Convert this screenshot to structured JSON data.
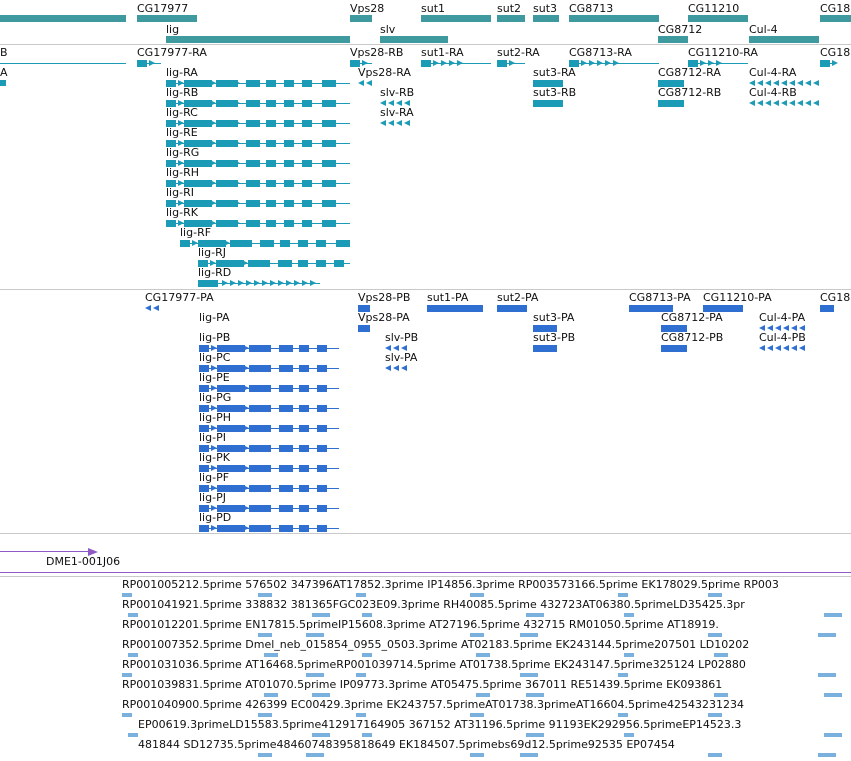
{
  "colors": {
    "gene": "#3f9aa0",
    "transcript_rna": "#1b9bb5",
    "transcript_protein": "#2e6fd1",
    "clone": "#8f5ac6",
    "est": "#79b0dd",
    "separator": "#c9c9c9"
  },
  "tracks": {
    "genes": {
      "labels": [
        "CG17977",
        "Vps28",
        "sut1",
        "sut2",
        "sut3",
        "CG8713",
        "CG11210",
        "CG18",
        "lig",
        "slv",
        "CG8712",
        "Cul-4"
      ]
    },
    "transcripts": {
      "labels": [
        "B",
        "A",
        "CG17977-RA",
        "Vps28-RB",
        "sut1-RA",
        "sut2-RA",
        "CG8713-RA",
        "CG11210-RA",
        "CG18",
        "lig-RA",
        "Vps28-RA",
        "sut3-RA",
        "CG8712-RA",
        "Cul-4-RA",
        "lig-RB",
        "slv-RB",
        "sut3-RB",
        "CG8712-RB",
        "Cul-4-RB",
        "lig-RC",
        "slv-RA",
        "lig-RE",
        "lig-RG",
        "lig-RH",
        "lig-RI",
        "lig-RK",
        "lig-RF",
        "lig-RJ",
        "lig-RD"
      ]
    },
    "proteins": {
      "labels": [
        "CG17977-PA",
        "Vps28-PB",
        "sut1-PA",
        "sut2-PA",
        "CG8713-PA",
        "CG11210-PA",
        "CG18",
        "lig-PA",
        "Vps28-PA",
        "sut3-PA",
        "CG8712-PA",
        "Cul-4-PA",
        "lig-PB",
        "slv-PB",
        "sut3-PB",
        "CG8712-PB",
        "Cul-4-PB",
        "lig-PC",
        "slv-PA",
        "lig-PE",
        "lig-PG",
        "lig-PH",
        "lig-PI",
        "lig-PK",
        "lig-PF",
        "lig-PJ",
        "lig-PD"
      ]
    },
    "clones": {
      "labels": [
        "DME1-001J06"
      ]
    },
    "ests": {
      "rows": [
        "RP001005212.5prime 576502 347396AT17852.3prime IP14856.3prime RP003573166.5prime EK178029.5prime RP003",
        "RP001041921.5prime 338832 381365FGC023E09.3prime RH40085.5prime 432723AT06380.5primeLD35425.3pr",
        "RP001012201.5prime EN17815.5primeIP15608.3prime AT27196.5prime 432715 RM01050.5prime AT18919.",
        "RP001007352.5prime Dmel_neb_015854_0955_0503.3prime AT02183.5prime EK243144.5prime207501 LD10202",
        "RP001031036.5prime AT16468.5primeRP001039714.5prime AT01738.5prime EK243147.5prime325124 LP02880",
        "RP001039831.5prime AT01070.5prime IP09773.3prime AT05475.5prime 367011 RE51439.5prime EK093861",
        "RP001040900.5prime 426399 EC00429.3prime EK243757.5primeAT01738.3primeAT16604.5prime42543231234",
        "EP00619.3primeLD15583.5prime412917164905 367152 AT31196.5prime 91193EK292956.5primeEP14523.3",
        "481844 SD12735.5prime48460748395818649 EK184507.5primebs69d12.5prime92535 EP07454"
      ]
    }
  }
}
